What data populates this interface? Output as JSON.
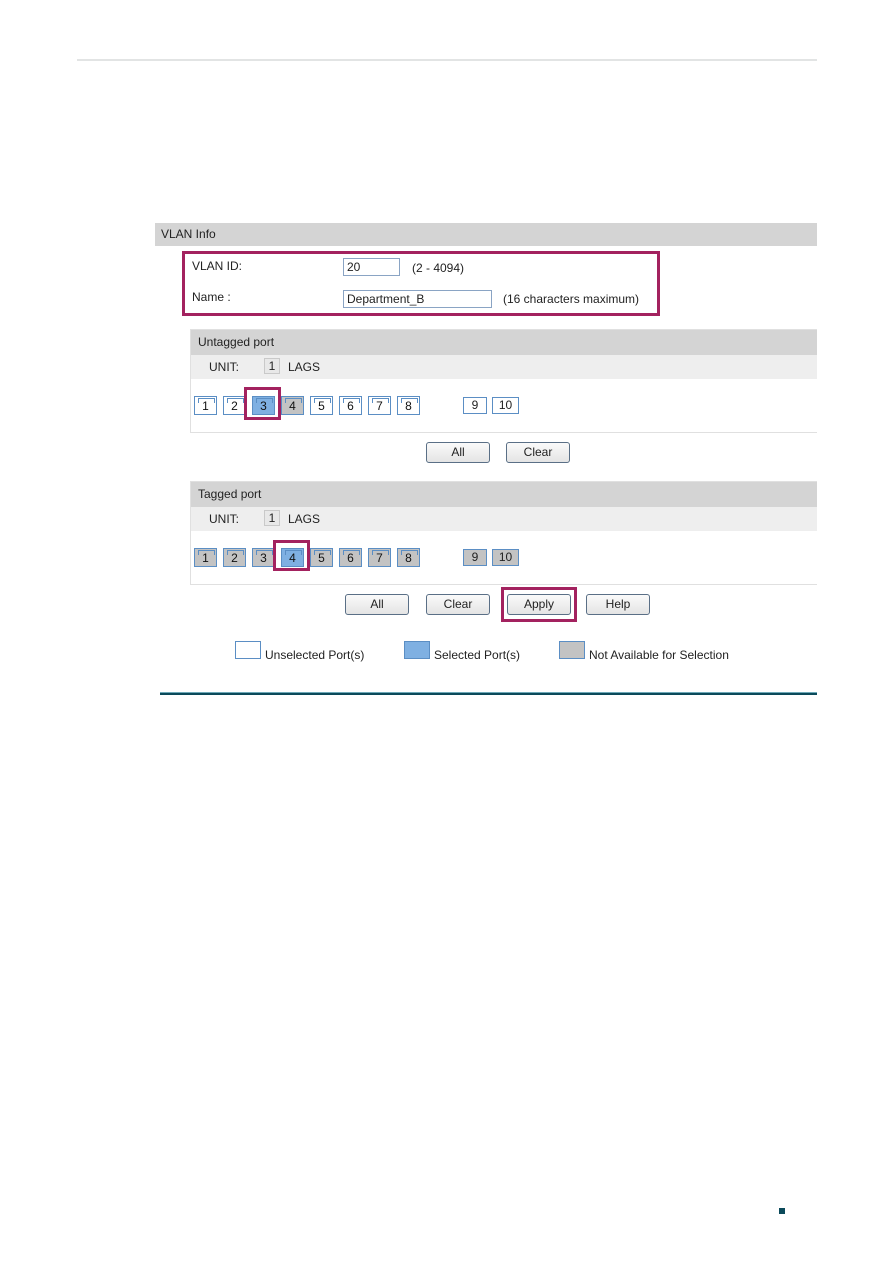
{
  "vlan_info": {
    "section_title": "VLAN Info",
    "vlan_id_label": "VLAN ID:",
    "vlan_id_value": "20",
    "vlan_id_hint": "(2 - 4094)",
    "name_label": "Name :",
    "name_value": "Department_B",
    "name_hint": "(16 characters maximum)"
  },
  "untagged": {
    "title": "Untagged port",
    "unit_label": "UNIT:",
    "unit_value": "1",
    "lags_label": "LAGS",
    "ports": [
      {
        "label": "1",
        "state": "unselected"
      },
      {
        "label": "2",
        "state": "unselected"
      },
      {
        "label": "3",
        "state": "selected"
      },
      {
        "label": "4",
        "state": "unavailable"
      },
      {
        "label": "5",
        "state": "unselected"
      },
      {
        "label": "6",
        "state": "unselected"
      },
      {
        "label": "7",
        "state": "unselected"
      },
      {
        "label": "8",
        "state": "unselected"
      }
    ],
    "lags": [
      {
        "label": "9",
        "state": "unselected"
      },
      {
        "label": "10",
        "state": "unselected"
      }
    ],
    "buttons": {
      "all": "All",
      "clear": "Clear"
    }
  },
  "tagged": {
    "title": "Tagged port",
    "unit_label": "UNIT:",
    "unit_value": "1",
    "lags_label": "LAGS",
    "ports": [
      {
        "label": "1",
        "state": "unavailable"
      },
      {
        "label": "2",
        "state": "unavailable"
      },
      {
        "label": "3",
        "state": "unavailable"
      },
      {
        "label": "4",
        "state": "selected"
      },
      {
        "label": "5",
        "state": "unavailable"
      },
      {
        "label": "6",
        "state": "unavailable"
      },
      {
        "label": "7",
        "state": "unavailable"
      },
      {
        "label": "8",
        "state": "unavailable"
      }
    ],
    "lags": [
      {
        "label": "9",
        "state": "unavailable"
      },
      {
        "label": "10",
        "state": "unavailable"
      }
    ],
    "buttons": {
      "all": "All",
      "clear": "Clear",
      "apply": "Apply",
      "help": "Help"
    }
  },
  "legend": {
    "unselected": "Unselected Port(s)",
    "selected": "Selected Port(s)",
    "unavailable": "Not Available for Selection"
  },
  "colors": {
    "highlight": "#a3225f",
    "selected_port": "#7fb0e2",
    "unavailable_port": "#c3c3c3",
    "rule": "#0b4a5a"
  }
}
